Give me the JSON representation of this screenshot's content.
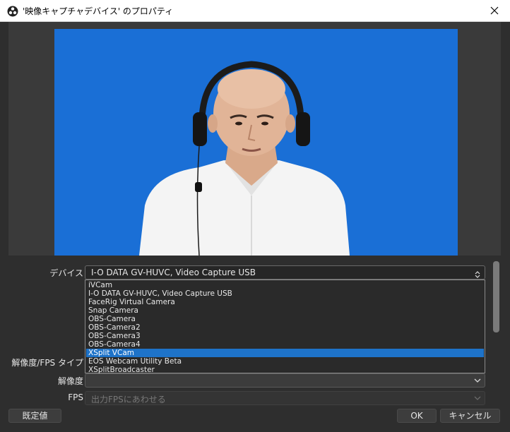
{
  "window": {
    "title": "'映像キャプチャデバイス' のプロパティ"
  },
  "form": {
    "device_label": "デバイス",
    "device_value": "I-O DATA GV-HUVC, Video Capture USB",
    "resolution_fps_type_label": "解像度/FPS タイプ",
    "resolution_label": "解像度",
    "resolution_value": "",
    "fps_label": "FPS",
    "fps_value": "出力FPSにあわせる"
  },
  "device_dropdown": {
    "options": [
      "iVCam",
      "I-O DATA GV-HUVC, Video Capture USB",
      "FaceRig Virtual Camera",
      "Snap Camera",
      "OBS-Camera",
      "OBS-Camera2",
      "OBS-Camera3",
      "OBS-Camera4",
      "XSplit VCam",
      "EOS Webcam Utility Beta",
      "XSplitBroadcaster"
    ],
    "highlighted": "XSplit VCam"
  },
  "buttons": {
    "defaults_label": "既定値",
    "ok_label": "OK",
    "cancel_label": "キャンセル"
  },
  "colors": {
    "preview_background": "#1a6fd6",
    "selection": "#1e73c9",
    "dialog_background": "#2e2e2e"
  },
  "icons": {
    "app": "obs-logo-icon",
    "close": "close-icon",
    "combo": "chevron-updown-icon"
  }
}
